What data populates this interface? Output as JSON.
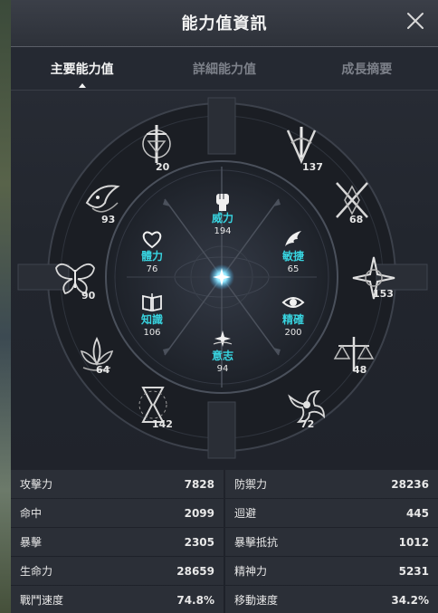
{
  "window": {
    "title": "能力值資訊",
    "close_icon": "close-icon"
  },
  "tabs": [
    {
      "label": "主要能力值",
      "active": true
    },
    {
      "label": "詳細能力值",
      "active": false
    },
    {
      "label": "成長摘要",
      "active": false
    }
  ],
  "inner_stats": [
    {
      "key": "power",
      "label": "威力",
      "value": "194",
      "icon": "fist-icon"
    },
    {
      "key": "health",
      "label": "體力",
      "value": "76",
      "icon": "heart-icon"
    },
    {
      "key": "agility",
      "label": "敏捷",
      "value": "65",
      "icon": "wing-icon"
    },
    {
      "key": "knowledge",
      "label": "知識",
      "value": "106",
      "icon": "book-icon"
    },
    {
      "key": "precision",
      "label": "精確",
      "value": "200",
      "icon": "eye-icon"
    },
    {
      "key": "will",
      "label": "意志",
      "value": "94",
      "icon": "spark-icon"
    }
  ],
  "outer_emblems": [
    {
      "key": "sword",
      "value": "20",
      "icon": "sword-emblem-icon"
    },
    {
      "key": "blade",
      "value": "137",
      "icon": "blade-emblem-icon"
    },
    {
      "key": "bird",
      "value": "93",
      "icon": "bird-emblem-icon"
    },
    {
      "key": "cross",
      "value": "68",
      "icon": "crossed-blades-emblem-icon"
    },
    {
      "key": "butterfly",
      "value": "90",
      "icon": "butterfly-emblem-icon"
    },
    {
      "key": "star",
      "value": "153",
      "icon": "star-emblem-icon"
    },
    {
      "key": "lotus",
      "value": "64",
      "icon": "lotus-emblem-icon"
    },
    {
      "key": "scale",
      "value": "48",
      "icon": "scale-emblem-icon"
    },
    {
      "key": "hourglass",
      "value": "142",
      "icon": "hourglass-emblem-icon"
    },
    {
      "key": "swirl",
      "value": "72",
      "icon": "swirl-emblem-icon"
    }
  ],
  "stats": [
    [
      {
        "label": "攻擊力",
        "value": "7828"
      },
      {
        "label": "防禦力",
        "value": "28236"
      }
    ],
    [
      {
        "label": "命中",
        "value": "2099"
      },
      {
        "label": "迴避",
        "value": "445"
      }
    ],
    [
      {
        "label": "暴擊",
        "value": "2305"
      },
      {
        "label": "暴擊抵抗",
        "value": "1012"
      }
    ],
    [
      {
        "label": "生命力",
        "value": "28659"
      },
      {
        "label": "精神力",
        "value": "5231"
      }
    ],
    [
      {
        "label": "戰鬥速度",
        "value": "74.8%"
      },
      {
        "label": "移動速度",
        "value": "34.2%"
      }
    ]
  ],
  "colors": {
    "accent": "#38d4e0",
    "panel": "#22262e",
    "row": "#2b2f37"
  }
}
